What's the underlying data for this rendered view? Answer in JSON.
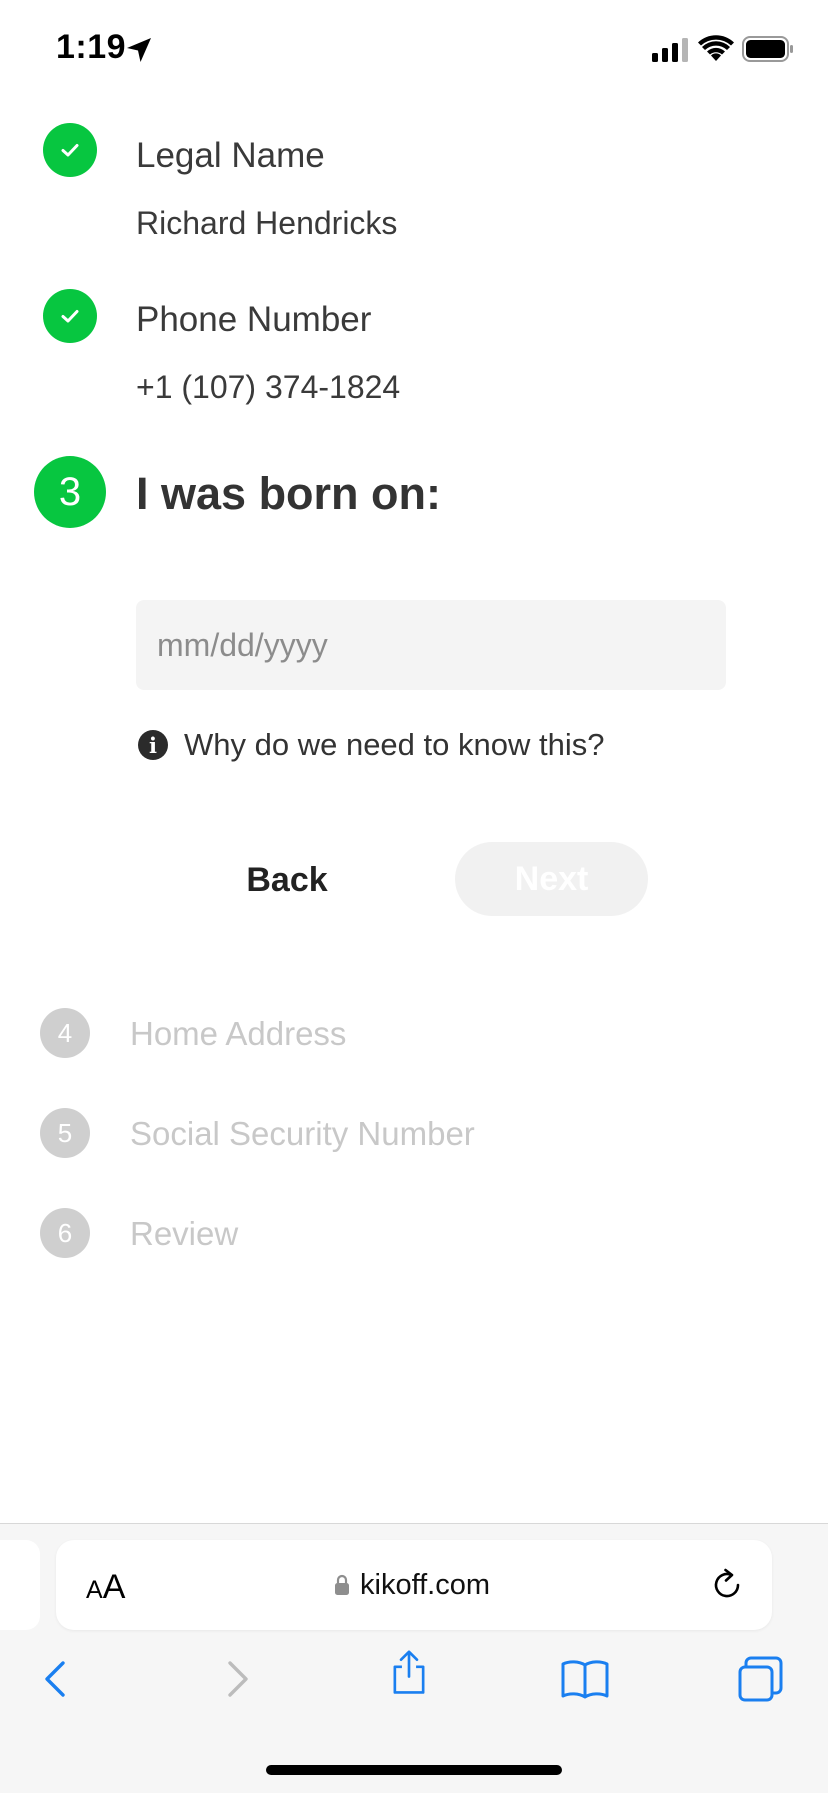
{
  "status_bar": {
    "time": "1:19"
  },
  "steps": {
    "completed": [
      {
        "title": "Legal Name",
        "value": "Richard Hendricks"
      },
      {
        "title": "Phone Number",
        "value": "+1 (107) 374-1824"
      }
    ],
    "active": {
      "number": "3",
      "title": "I was born on:",
      "input_placeholder": "mm/dd/yyyy",
      "input_value": "",
      "info_text": "Why do we need to know this?",
      "back_label": "Back",
      "next_label": "Next"
    },
    "pending": [
      {
        "number": "4",
        "label": "Home Address"
      },
      {
        "number": "5",
        "label": "Social Security Number"
      },
      {
        "number": "6",
        "label": "Review"
      }
    ]
  },
  "browser": {
    "text_size_label_small": "A",
    "text_size_label_large": "A",
    "url": "kikoff.com",
    "toolbar_icons": [
      "back-icon",
      "forward-icon",
      "share-icon",
      "bookmarks-icon",
      "tabs-icon"
    ]
  },
  "colors": {
    "accent": "#07c640",
    "pending": "#cfcfcf",
    "ios_blue": "#1a7ff0"
  }
}
